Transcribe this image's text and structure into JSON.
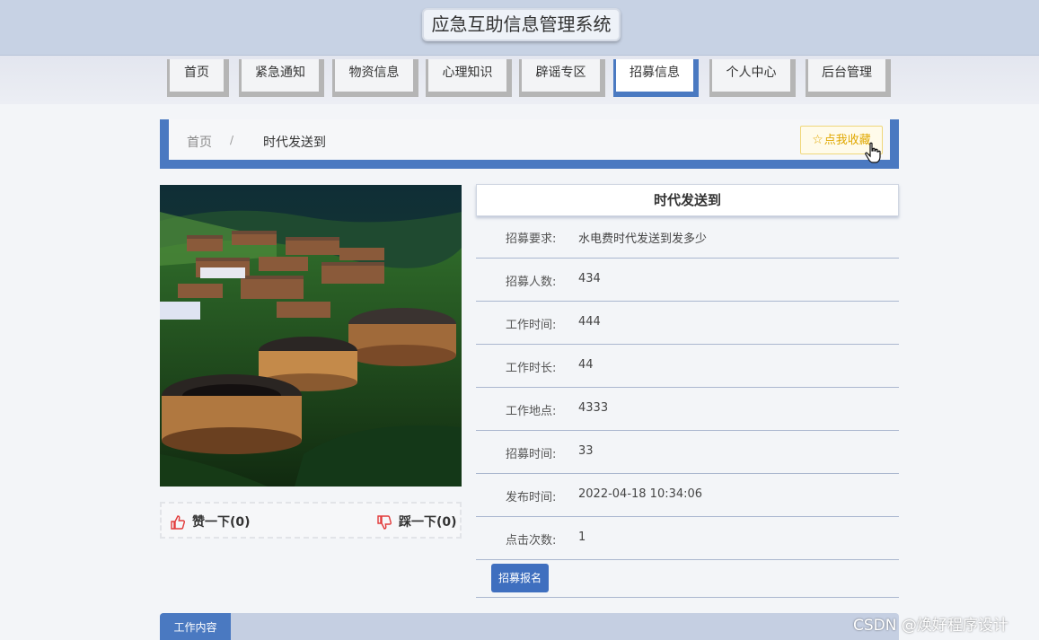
{
  "header": {
    "title": "应急互助信息管理系统"
  },
  "nav": {
    "items": [
      {
        "label": "首页"
      },
      {
        "label": "紧急通知"
      },
      {
        "label": "物资信息"
      },
      {
        "label": "心理知识"
      },
      {
        "label": "辟谣专区"
      },
      {
        "label": "招募信息"
      },
      {
        "label": "个人中心"
      },
      {
        "label": "后台管理"
      }
    ],
    "active": "招募信息"
  },
  "breadcrumb": {
    "home": "首页",
    "separator": "/",
    "current": "时代发送到"
  },
  "favorite": {
    "label": "点我收藏",
    "icon": "star-icon"
  },
  "votes": {
    "like_label": "赞一下(0)",
    "dislike_label": "踩一下(0)",
    "like_icon": "thumbs-up-icon",
    "dislike_icon": "thumbs-down-icon"
  },
  "detail": {
    "title": "时代发送到",
    "fields": [
      {
        "label": "招募要求:",
        "value": "水电费时代发送到发多少"
      },
      {
        "label": "招募人数:",
        "value": "434"
      },
      {
        "label": "工作时间:",
        "value": "444"
      },
      {
        "label": "工作时长:",
        "value": "44"
      },
      {
        "label": "工作地点:",
        "value": "4333"
      },
      {
        "label": "招募时间:",
        "value": "33"
      },
      {
        "label": "发布时间:",
        "value": "2022-04-18 10:34:06"
      },
      {
        "label": "点击次数:",
        "value": "1"
      }
    ],
    "signup_label": "招募报名"
  },
  "tabs": {
    "work_content": "工作内容"
  },
  "watermark": "CSDN @焕好程序设计",
  "colors": {
    "accent": "#4a79c1",
    "header_bg": "#c7d2e4",
    "favorite": "#e0a800",
    "vote_icon": "#e23b3b"
  }
}
